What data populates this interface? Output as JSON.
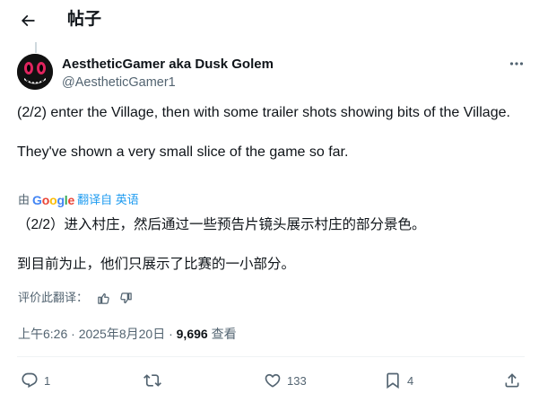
{
  "header": {
    "title": "帖子"
  },
  "author": {
    "display_name": "AestheticGamer aka Dusk Golem",
    "handle": "@AestheticGamer1"
  },
  "tweet": {
    "text": "(2/2) enter the Village, then with some trailer shots showing bits of the Village.\n\nThey've shown a very small slice of the game so far."
  },
  "translation": {
    "by_prefix": "由",
    "provider": "Google",
    "link_label": "翻译自 英语",
    "text": "（2/2）进入村庄，然后通过一些预告片镜头展示村庄的部分景色。\n\n到目前为止，他们只展示了比赛的一小部分。",
    "rate_label": "评价此翻译："
  },
  "meta": {
    "time_date": "上午6:26 · 2025年8月20日 · ",
    "views_count": "9,696",
    "views_label": " 查看"
  },
  "actions": {
    "replies": "1",
    "reposts": "",
    "likes": "133",
    "bookmarks": "4"
  },
  "colors": {
    "accent": "#1d9bf0",
    "secondary_text": "#536471",
    "avatar_eyes": "#e0245e"
  },
  "icons": [
    "back-arrow-icon",
    "more-icon",
    "thumbs-up-icon",
    "thumbs-down-icon",
    "reply-icon",
    "retweet-icon",
    "like-icon",
    "bookmark-icon",
    "share-icon"
  ]
}
